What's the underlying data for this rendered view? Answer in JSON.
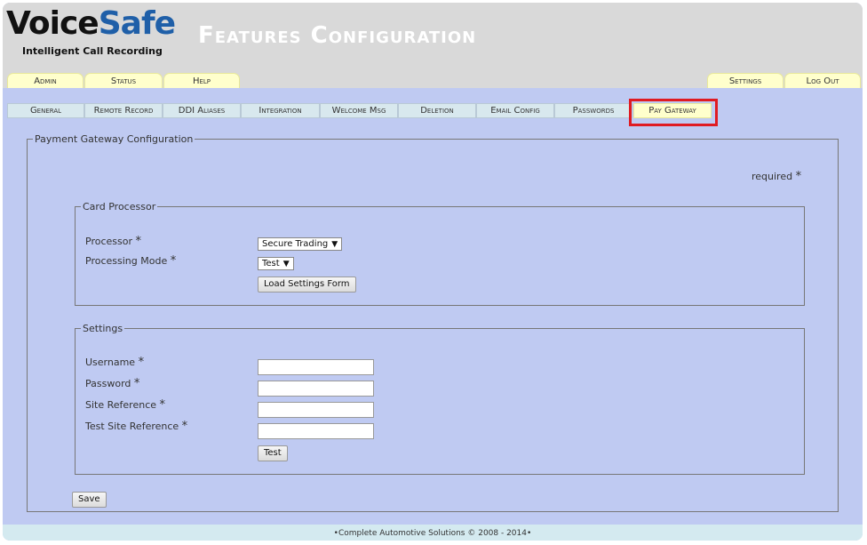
{
  "brand": {
    "name_part1": "Voice",
    "name_part2": "Safe",
    "tagline": "Intelligent Call Recording",
    "colors": {
      "brand_dark": "#111111",
      "brand_blue": "#1f5fa8"
    }
  },
  "page_title": "Features Configuration",
  "top_nav": {
    "admin": "Admin",
    "status": "Status",
    "help": "Help",
    "settings": "Settings",
    "logout": "Log Out"
  },
  "sub_nav": {
    "general": "General",
    "remote_record": "Remote Record",
    "ddi_aliases": "DDI Aliases",
    "integration": "Integration",
    "welcome_msg": "Welcome Msg",
    "deletion": "Deletion",
    "email_config": "Email Config",
    "passwords": "Passwords",
    "pay_gateway": "Pay Gateway",
    "active": "Pay Gateway",
    "highlight_color": "#e01b22"
  },
  "form": {
    "legend": "Payment Gateway Configuration",
    "required_text": "required",
    "required_mark": "*",
    "card_processor": {
      "legend": "Card Processor",
      "processor_label": "Processor",
      "processor_value": "Secure Trading",
      "mode_label": "Processing Mode",
      "mode_value": "Test",
      "load_button": "Load Settings Form"
    },
    "settings": {
      "legend": "Settings",
      "username_label": "Username",
      "username_value": "",
      "password_label": "Password",
      "password_value": "",
      "site_ref_label": "Site Reference",
      "site_ref_value": "",
      "test_site_ref_label": "Test Site Reference",
      "test_site_ref_value": "",
      "test_button": "Test"
    },
    "save_button": "Save"
  },
  "footer": "•Complete Automotive Solutions © 2008 - 2014•"
}
